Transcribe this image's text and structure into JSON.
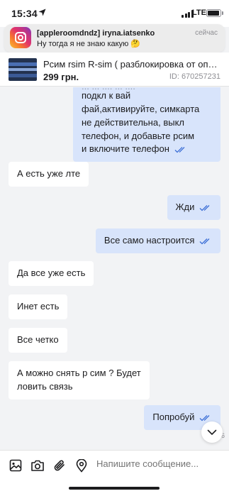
{
  "status_bar": {
    "time": "15:34",
    "network": "LTE",
    "battery_level": 0.92
  },
  "notification": {
    "title": "[appleroomdndz] iryna.iatsenko",
    "text": "Ну тогда я не знаю какую 🤔",
    "time": "сейчас",
    "app_icon": "instagram-icon"
  },
  "product": {
    "title": "Рсим rsim R-sim ( разблокировка от опер...",
    "price": "299 грн.",
    "id": "ID: 670257231"
  },
  "messages": [
    {
      "dir": "out",
      "text": "подкл к вай\nфай,активируйте, симкарта\nне действительна, выкл\nтелефон, и добавьте рсим\nи включите телефон",
      "read": true
    },
    {
      "dir": "in",
      "text": "А есть уже лте"
    },
    {
      "dir": "out",
      "text": "Жди",
      "read": true
    },
    {
      "dir": "out",
      "text": "Все само настроится",
      "read": true
    },
    {
      "dir": "in",
      "text": "Да все уже есть"
    },
    {
      "dir": "in",
      "text": "Инет есть"
    },
    {
      "dir": "in",
      "text": "Все четко"
    },
    {
      "dir": "in",
      "text": "А можно снять р сим ? Будет\nловить связь"
    },
    {
      "dir": "out",
      "text": "Попробуй",
      "read": true
    }
  ],
  "time_fragment": "16",
  "composer": {
    "placeholder": "Напишите сообщение..."
  },
  "colors": {
    "accent": "#3d6fd6",
    "outgoing_bubble": "#d8e4fb",
    "incoming_bubble": "#ffffff",
    "background": "#f2f3f5"
  }
}
